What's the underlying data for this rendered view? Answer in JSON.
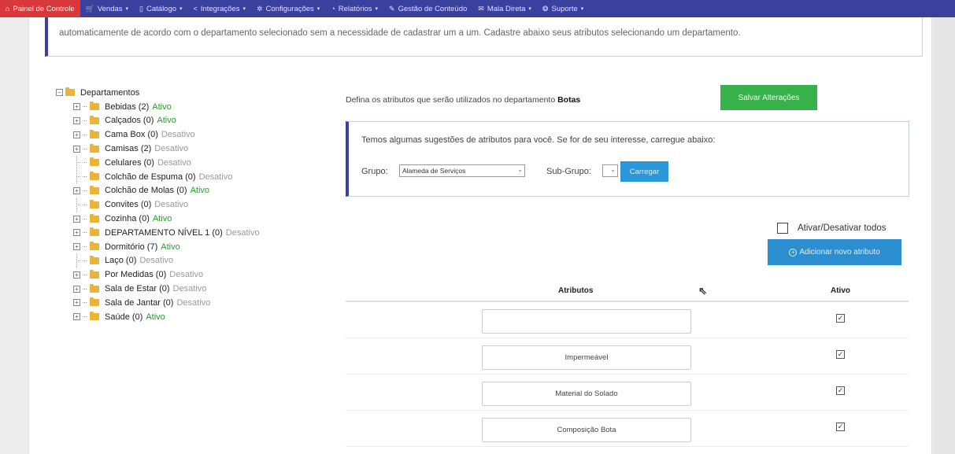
{
  "nav": [
    {
      "icon": "home-icon",
      "glyph": "⌂",
      "label": "Painel de Controle",
      "caret": false
    },
    {
      "icon": "cart-icon",
      "glyph": "🛒",
      "label": "Vendas",
      "caret": true
    },
    {
      "icon": "catalog-icon",
      "glyph": "▯",
      "label": "Catálogo",
      "caret": true
    },
    {
      "icon": "share-icon",
      "glyph": "<",
      "label": "Integrações",
      "caret": true
    },
    {
      "icon": "gear-icon",
      "glyph": "✲",
      "label": "Configurações",
      "caret": true
    },
    {
      "icon": "reports-icon",
      "glyph": "◔",
      "label": "Relatórios",
      "caret": true
    },
    {
      "icon": "edit-icon",
      "glyph": "✎",
      "label": "Gestão de Conteúdo",
      "caret": false
    },
    {
      "icon": "mail-icon",
      "glyph": "✉",
      "label": "Mala Direta",
      "caret": true
    },
    {
      "icon": "support-icon",
      "glyph": "❂",
      "label": "Suporte",
      "caret": true
    }
  ],
  "alert_text": "automaticamente de acordo com o departamento selecionado sem a necessidade de cadastrar um a um. Cadastre abaixo seus atributos selecionando um departamento.",
  "tree": {
    "root_label": "Departamentos",
    "items": [
      {
        "name": "Bebidas (2)",
        "status": "Ativo",
        "active": true,
        "expandable": true
      },
      {
        "name": "Calçados (0)",
        "status": "Ativo",
        "active": true,
        "expandable": true
      },
      {
        "name": "Cama Box (0)",
        "status": "Desativo",
        "active": false,
        "expandable": true
      },
      {
        "name": "Camisas (2)",
        "status": "Desativo",
        "active": false,
        "expandable": true
      },
      {
        "name": "Celulares (0)",
        "status": "Desativo",
        "active": false,
        "expandable": false
      },
      {
        "name": "Colchão de Espuma (0)",
        "status": "Desativo",
        "active": false,
        "expandable": false
      },
      {
        "name": "Colchão de Molas (0)",
        "status": "Ativo",
        "active": true,
        "expandable": true
      },
      {
        "name": "Convites (0)",
        "status": "Desativo",
        "active": false,
        "expandable": false
      },
      {
        "name": "Cozinha (0)",
        "status": "Ativo",
        "active": true,
        "expandable": true
      },
      {
        "name": "DEPARTAMENTO NÍVEL 1 (0)",
        "status": "Desativo",
        "active": false,
        "expandable": true
      },
      {
        "name": "Dormitório (7)",
        "status": "Ativo",
        "active": true,
        "expandable": true
      },
      {
        "name": "Laço (0)",
        "status": "Desativo",
        "active": false,
        "expandable": false
      },
      {
        "name": "Por Medidas (0)",
        "status": "Desativo",
        "active": false,
        "expandable": true
      },
      {
        "name": "Sala de Estar (0)",
        "status": "Desativo",
        "active": false,
        "expandable": true
      },
      {
        "name": "Sala de Jantar (0)",
        "status": "Desativo",
        "active": false,
        "expandable": true
      },
      {
        "name": "Saúde (0)",
        "status": "Ativo",
        "active": true,
        "expandable": true
      }
    ]
  },
  "define": {
    "prefix": "Defina os atributos que serão utilizados no departamento ",
    "department": "Botas"
  },
  "save_button": "Salvar Alterações",
  "suggest": {
    "text": "Temos algumas sugestões de atributos para você. Se for de seu interesse, carregue abaixo:",
    "group_label": "Grupo:",
    "group_value": "Alameda de Serviços",
    "subgroup_label": "Sub-Grupo:",
    "subgroup_value": "",
    "load_button": "Carregar"
  },
  "toggle_all_label": "Ativar/Desativar todos",
  "add_button": "Adicionar novo atributo",
  "table": {
    "col_attr": "Atributos",
    "col_active": "Ativo",
    "rows": [
      {
        "value": "",
        "active": true
      },
      {
        "value": "Impermeável",
        "active": true
      },
      {
        "value": "Material do Solado",
        "active": true
      },
      {
        "value": "Composição Bota",
        "active": true
      }
    ]
  }
}
